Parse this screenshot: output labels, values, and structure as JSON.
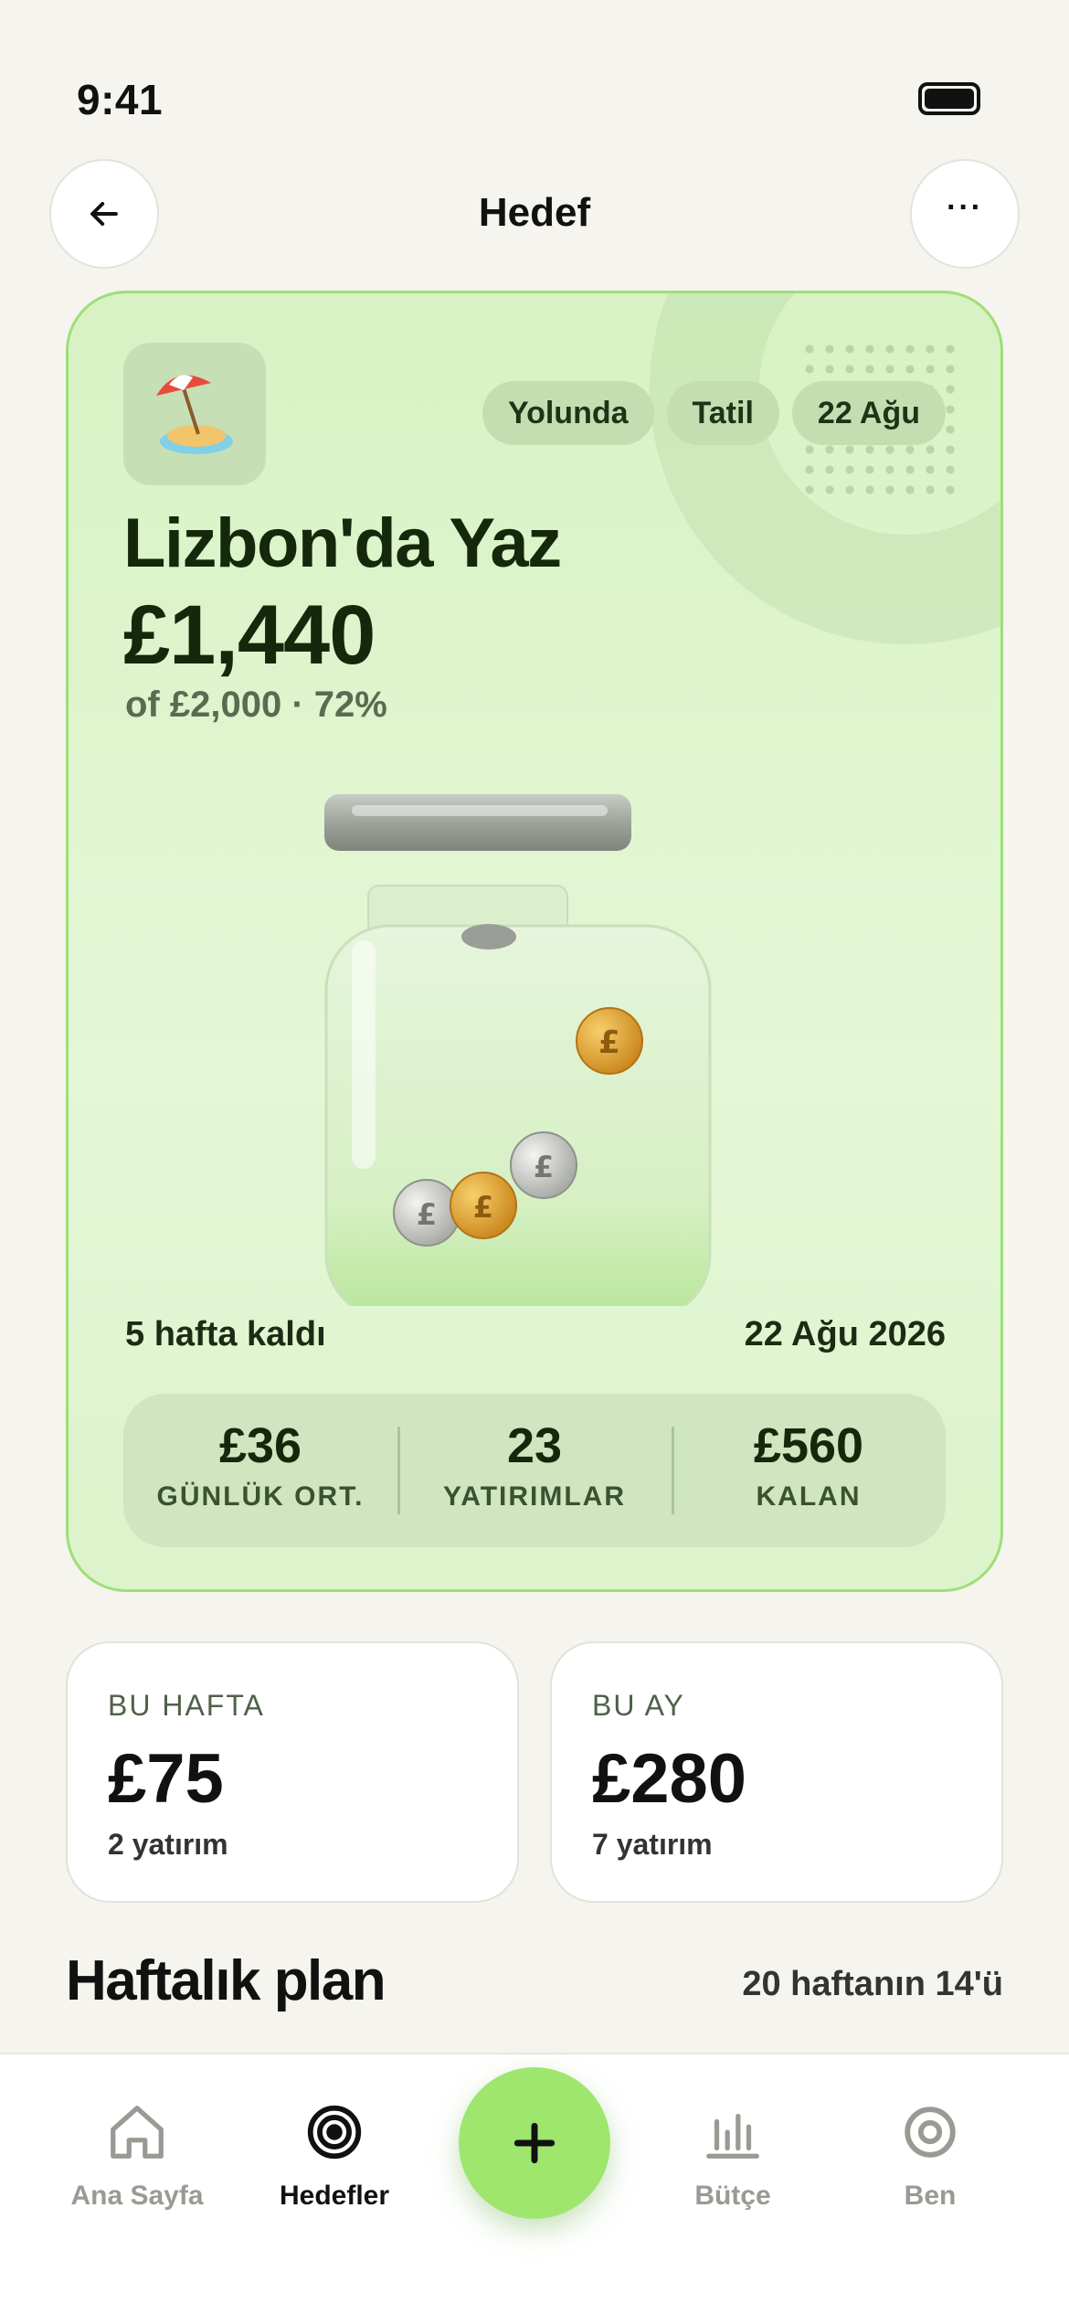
{
  "status_bar": {
    "time": "9:41"
  },
  "nav": {
    "title": "Hedef",
    "more_label": "···"
  },
  "goal": {
    "emoji": "🏖️",
    "chips": [
      "Yolunda",
      "Tatil",
      "22 Ağu"
    ],
    "title": "Lizbon'da Yaz",
    "amount": "£1,440",
    "subtitle": "of £2,000 · 72%",
    "progress_percent": 72,
    "weeks_left": "5 hafta kaldı",
    "end_date": "22 Ağu 2026",
    "stats": [
      {
        "value": "£36",
        "label": "GÜNLÜK ORT."
      },
      {
        "value": "23",
        "label": "YATIRIMLAR"
      },
      {
        "value": "£560",
        "label": "KALAN"
      }
    ],
    "coin_symbol": "£"
  },
  "summary": {
    "week": {
      "label": "BU HAFTA",
      "value": "£75",
      "sub": "2 yatırım"
    },
    "month": {
      "label": "BU AY",
      "value": "£280",
      "sub": "7 yatırım"
    }
  },
  "plan": {
    "title": "Haftalık plan",
    "meta": "20 haftanın 14'ü"
  },
  "tabs": [
    {
      "label": "Ana Sayfa",
      "icon": "home-icon"
    },
    {
      "label": "Hedefler",
      "icon": "target-icon",
      "active": true
    },
    {
      "label": "Bütçe",
      "icon": "bar-chart-icon"
    },
    {
      "label": "Ben",
      "icon": "profile-icon"
    }
  ],
  "colors": {
    "accent": "#9ee66e",
    "card_bg": "#dcf3cb",
    "card_border": "#9fde78",
    "text_dark": "#14290c"
  }
}
